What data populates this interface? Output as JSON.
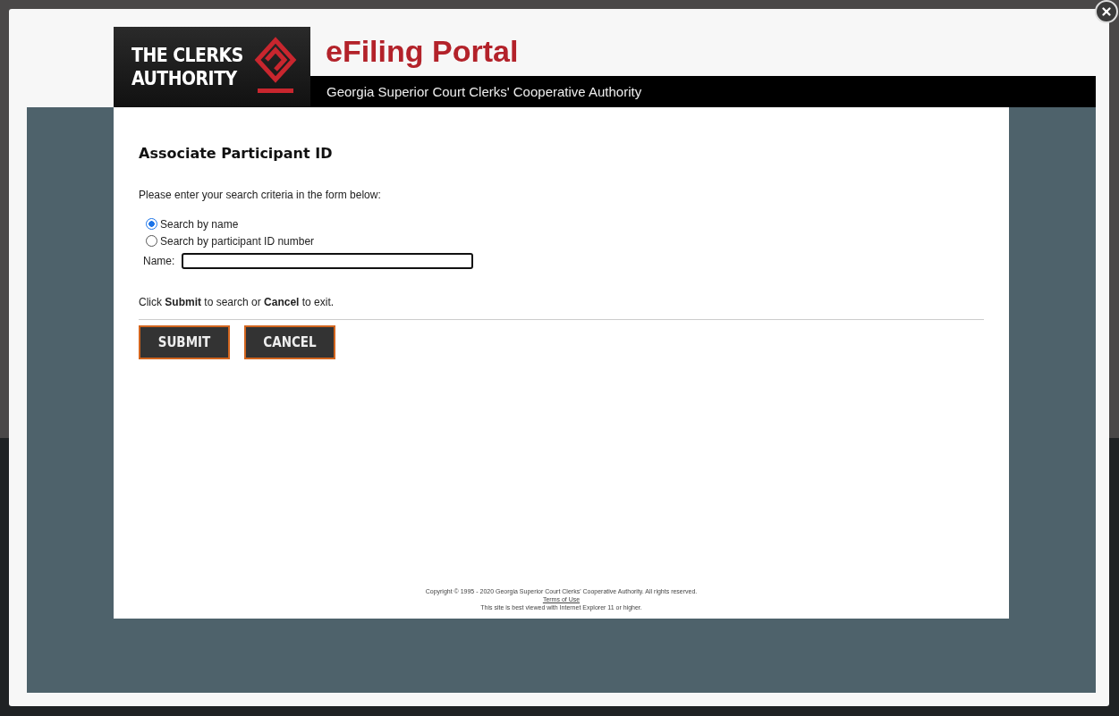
{
  "logo": {
    "lines": [
      "THE CLERKS",
      "AUTHORITY"
    ]
  },
  "header": {
    "title": "eFiling Portal",
    "subtitle": "Georgia Superior Court Clerks' Cooperative Authority"
  },
  "form": {
    "heading": "Associate Participant ID",
    "intro": "Please enter your search criteria in the form below:",
    "options": [
      {
        "label": "Search by name",
        "selected": true
      },
      {
        "label": "Search by participant ID number",
        "selected": false
      }
    ],
    "name_field": {
      "label": "Name:"
    },
    "instructions": "Click **Submit** to search or **Cancel** to exit.",
    "buttons": [
      "SUBMIT",
      "CANCEL"
    ]
  },
  "footer": {
    "copyright": "Copyright © 1995 - 2020 Georgia Superior Court Clerks' Cooperative Authority. All rights reserved.",
    "terms_link": "Terms of Use",
    "note": "This site is best viewed with Internet Explorer 11 or higher."
  }
}
